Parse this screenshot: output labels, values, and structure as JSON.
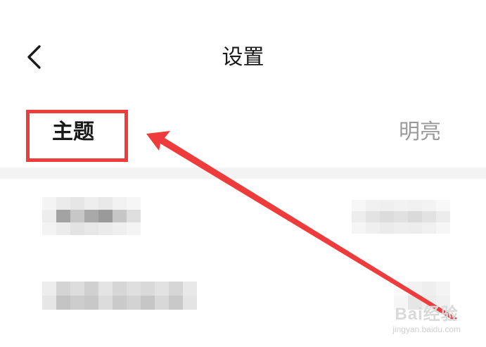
{
  "header": {
    "back_icon": "chevron-left-icon",
    "title": "设置"
  },
  "theme_setting": {
    "label": "主题",
    "value": "明亮"
  },
  "annotation": {
    "highlight_color": "#ee3b3b",
    "arrow_color": "#ee3b3b"
  },
  "watermark": {
    "logo": "Bai经验",
    "url": "jingyan.baidu.com"
  }
}
